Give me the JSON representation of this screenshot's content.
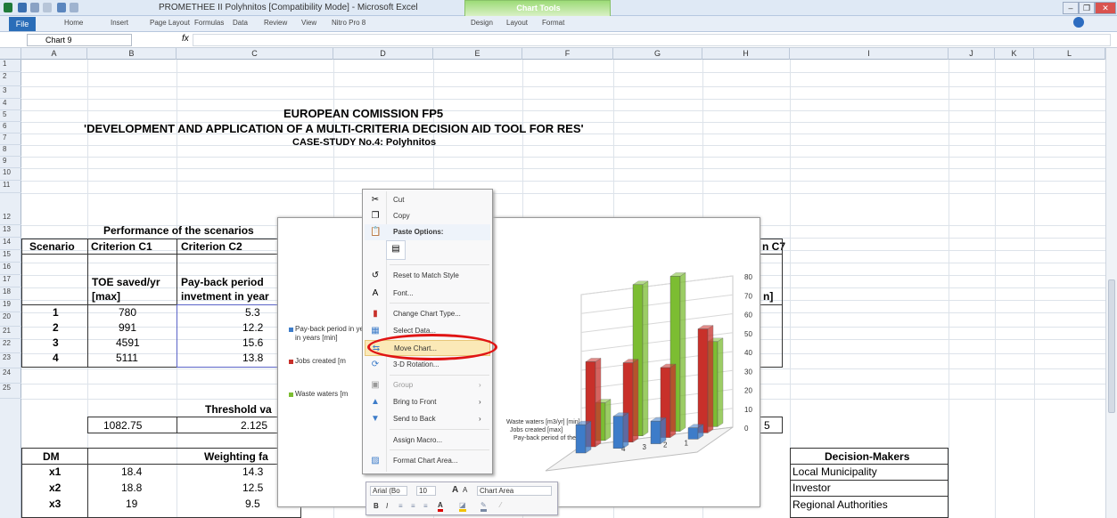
{
  "window": {
    "title": "PROMETHEE II Polyhnitos [Compatibility Mode] - Microsoft Excel",
    "chart_tools": "Chart Tools"
  },
  "ribbon": {
    "tabs": [
      "File",
      "Home",
      "Insert",
      "Page Layout",
      "Formulas",
      "Data",
      "Review",
      "View",
      "Nitro Pro 8",
      "Design",
      "Layout",
      "Format"
    ]
  },
  "formula_bar": {
    "name_box": "Chart 9",
    "fx": "fx",
    "formula": ""
  },
  "columns": [
    "A",
    "B",
    "C",
    "D",
    "E",
    "F",
    "G",
    "H",
    "I",
    "J",
    "K",
    "L"
  ],
  "rows": [
    "1",
    "2",
    "3",
    "4",
    "5",
    "6",
    "7",
    "8",
    "9",
    "10",
    "11",
    "12",
    "13",
    "14",
    "15",
    "16",
    "17",
    "18",
    "19",
    "20",
    "21",
    "22",
    "23",
    "24",
    "25"
  ],
  "sheet": {
    "title1": "EUROPEAN COMISSION FP5",
    "title2": "'DEVELOPMENT AND APPLICATION OF A MULTI-CRITERIA DECISION AID TOOL FOR RES'",
    "title3": "CASE-STUDY No.4: Polyhnitos",
    "perf_title": "Performance of the scenarios",
    "hdr_scenario": "Scenario",
    "hdr_c1": "Criterion C1",
    "hdr_c2": "Criterion C2",
    "hdr_c7": "n C7",
    "c1_sub1": "TOE saved/yr",
    "c1_sub2": "[max]",
    "c2_sub1": "Pay-back period",
    "c2_sub2": "invetment in year",
    "c7_sub": "n]",
    "scenarios": [
      "1",
      "2",
      "3",
      "4"
    ],
    "c1_vals": [
      "780",
      "991",
      "4591",
      "5111"
    ],
    "c2_vals": [
      "5.3",
      "12.2",
      "15.6",
      "13.8"
    ],
    "threshold_label": "Threshold va",
    "thr_b": "1082.75",
    "thr_c": "2.125",
    "thr_h": "5",
    "weight_label": "Weighting fa",
    "dm_hdr": "DM",
    "dms": [
      "x1",
      "x2",
      "x3"
    ],
    "w_b": [
      "18.4",
      "18.8",
      "19"
    ],
    "w_c": [
      "14.3",
      "12.5",
      "9.5"
    ],
    "dm_title": "Decision-Makers",
    "dm_names": [
      "Local Municipality",
      "Investor",
      "Regional Authorities"
    ]
  },
  "chart": {
    "legend": [
      "Pay-back period of the investment in years [min]",
      "Jobs created [max]",
      "Waste waters [m3/yr]"
    ],
    "legend_shown": [
      "Pay-back period in years [min]",
      "Jobs created [m",
      "Waste waters [m"
    ],
    "series_labels": [
      "Waste waters [m3/yr] [min]",
      "Jobs created [max]",
      "Pay-back period of the"
    ],
    "z_ticks": [
      "0",
      "10",
      "20",
      "30",
      "40",
      "50",
      "60",
      "70",
      "80"
    ],
    "x_ticks": [
      "4",
      "3",
      "2",
      "1"
    ],
    "colors": {
      "green": "#7cbd32",
      "red": "#c8302a",
      "blue": "#3d7cc9"
    }
  },
  "chart_data": {
    "type": "bar",
    "categories": [
      "4",
      "3",
      "2",
      "1"
    ],
    "series": [
      {
        "name": "Waste waters [m3/yr]",
        "values": [
          20,
          80,
          82,
          45
        ]
      },
      {
        "name": "Jobs created",
        "values": [
          45,
          42,
          37,
          55
        ]
      },
      {
        "name": "Pay-back period",
        "values": [
          15,
          17,
          12,
          6
        ]
      }
    ],
    "ylim": [
      0,
      80
    ]
  },
  "context_menu": {
    "items": [
      {
        "icon": "scissors-icon",
        "glyph": "✂",
        "label": "Cut"
      },
      {
        "icon": "copy-icon",
        "glyph": "❐",
        "label": "Copy"
      },
      {
        "icon": "clipboard-icon",
        "glyph": "📋",
        "label": "Paste Options:"
      },
      {
        "icon": "paste-option-icon",
        "glyph": "▤",
        "label": ""
      },
      {
        "icon": "reset-style-icon",
        "glyph": "↺",
        "label": "Reset to Match Style"
      },
      {
        "icon": "font-icon",
        "glyph": "A",
        "label": "Font..."
      },
      {
        "icon": "chart-type-icon",
        "glyph": "▮",
        "label": "Change Chart Type..."
      },
      {
        "icon": "select-data-icon",
        "glyph": "▦",
        "label": "Select Data..."
      },
      {
        "icon": "move-chart-icon",
        "glyph": "⇆",
        "label": "Move Chart..."
      },
      {
        "icon": "rotation-icon",
        "glyph": "⟳",
        "label": "3-D Rotation..."
      },
      {
        "icon": "group-icon",
        "glyph": "▣",
        "label": "Group"
      },
      {
        "icon": "bring-front-icon",
        "glyph": "▲",
        "label": "Bring to Front"
      },
      {
        "icon": "send-back-icon",
        "glyph": "▼",
        "label": "Send to Back"
      },
      {
        "icon": "macro-icon",
        "glyph": "",
        "label": "Assign Macro..."
      },
      {
        "icon": "format-chart-icon",
        "glyph": "▨",
        "label": "Format Chart Area..."
      }
    ]
  },
  "mini_toolbar": {
    "font": "Arial (Bo",
    "size": "10",
    "grow": "A",
    "shrink": "A",
    "element": "Chart Area",
    "bold": "B",
    "italic": "I"
  }
}
